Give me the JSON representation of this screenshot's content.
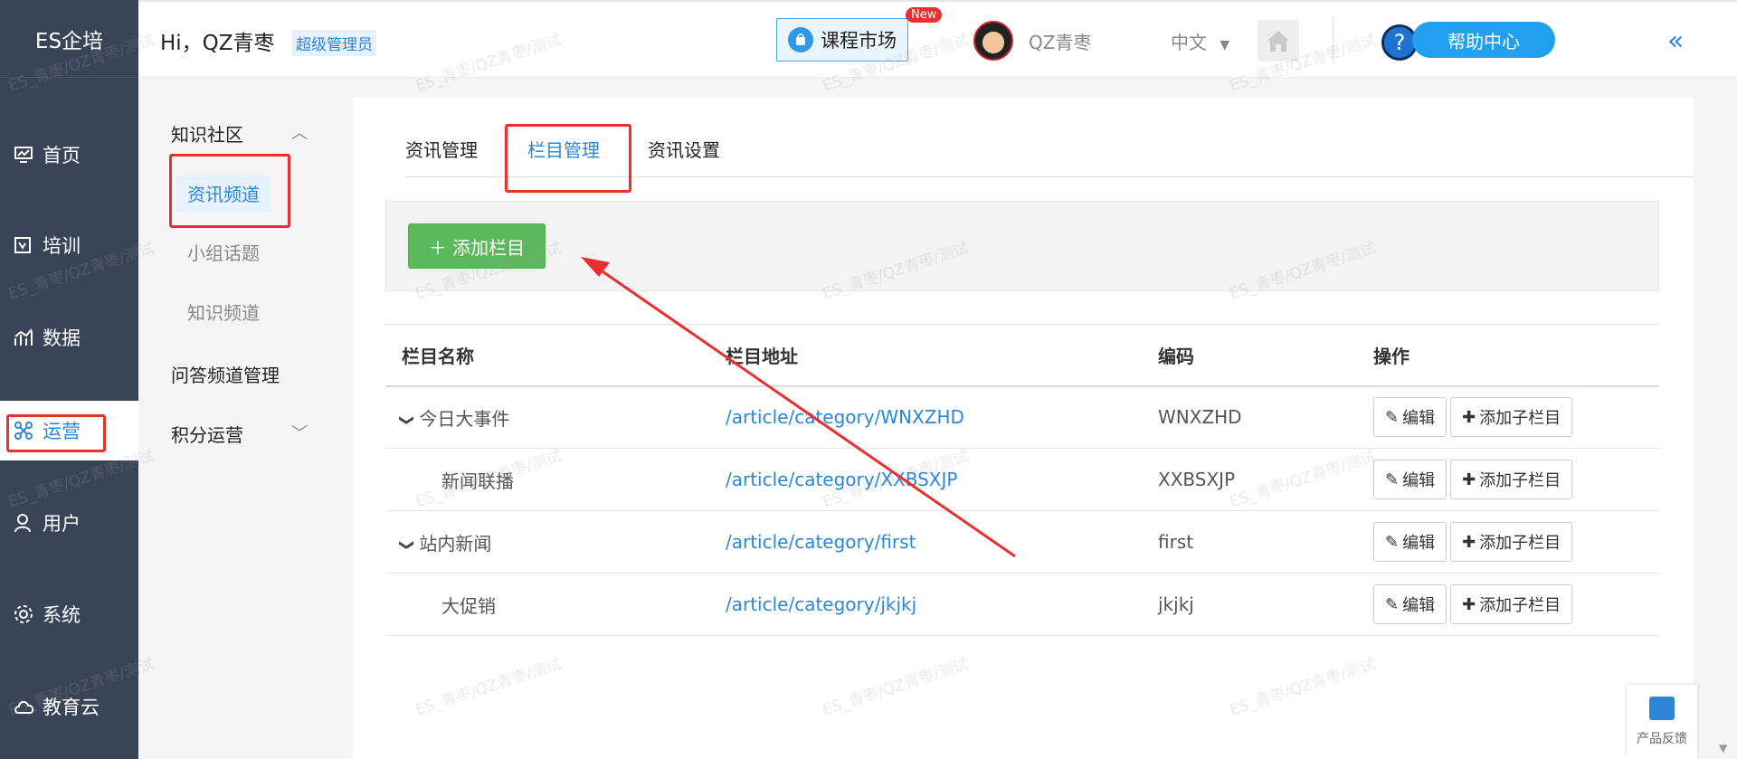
{
  "sidebar": {
    "logo": "ES企培",
    "items": [
      {
        "label": "首页",
        "icon": "dashboard-icon"
      },
      {
        "label": "培训",
        "icon": "training-icon"
      },
      {
        "label": "数据",
        "icon": "chart-icon"
      },
      {
        "label": "运营",
        "icon": "operation-icon",
        "active": true
      },
      {
        "label": "用户",
        "icon": "user-icon"
      },
      {
        "label": "系统",
        "icon": "gear-icon"
      },
      {
        "label": "教育云",
        "icon": "cloud-icon"
      }
    ]
  },
  "header": {
    "greeting": "Hi，QZ青枣",
    "role": "超级管理员",
    "market_label": "课程市场",
    "new_badge": "New",
    "username": "QZ青枣",
    "language": "中文",
    "help_icon_text": "?",
    "help_label": "帮助中心",
    "collapse_glyph": "«"
  },
  "submenu": {
    "group1": "知识社区",
    "items": [
      "资讯频道",
      "小组话题",
      "知识频道"
    ],
    "group2": "问答频道管理",
    "group3": "积分运营",
    "chevron_up": "︿",
    "chevron_down": "﹀"
  },
  "tabs": [
    "资讯管理",
    "栏目管理",
    "资讯设置"
  ],
  "toolbar": {
    "add_label": "＋ 添加栏目"
  },
  "table": {
    "headers": [
      "栏目名称",
      "栏目地址",
      "编码",
      "操作"
    ],
    "rows": [
      {
        "name": "今日大事件",
        "url": "/article/category/WNXZHD",
        "code": "WNXZHD",
        "level": "parent"
      },
      {
        "name": "新闻联播",
        "url": "/article/category/XXBSXJP",
        "code": "XXBSXJP",
        "level": "child"
      },
      {
        "name": "站内新闻",
        "url": "/article/category/first",
        "code": "first",
        "level": "parent"
      },
      {
        "name": "大促销",
        "url": "/article/category/jkjkj",
        "code": "jkjkj",
        "level": "child"
      }
    ],
    "edit_label": "编辑",
    "add_child_label": "添加子栏目"
  },
  "feedback": {
    "label": "产品反馈"
  },
  "watermark": "ES_青枣/QZ青枣/测试",
  "colors": {
    "accent": "#2b86d8",
    "sidebar": "#3a4459",
    "success": "#5cb85c",
    "annotation": "#e8312f"
  }
}
